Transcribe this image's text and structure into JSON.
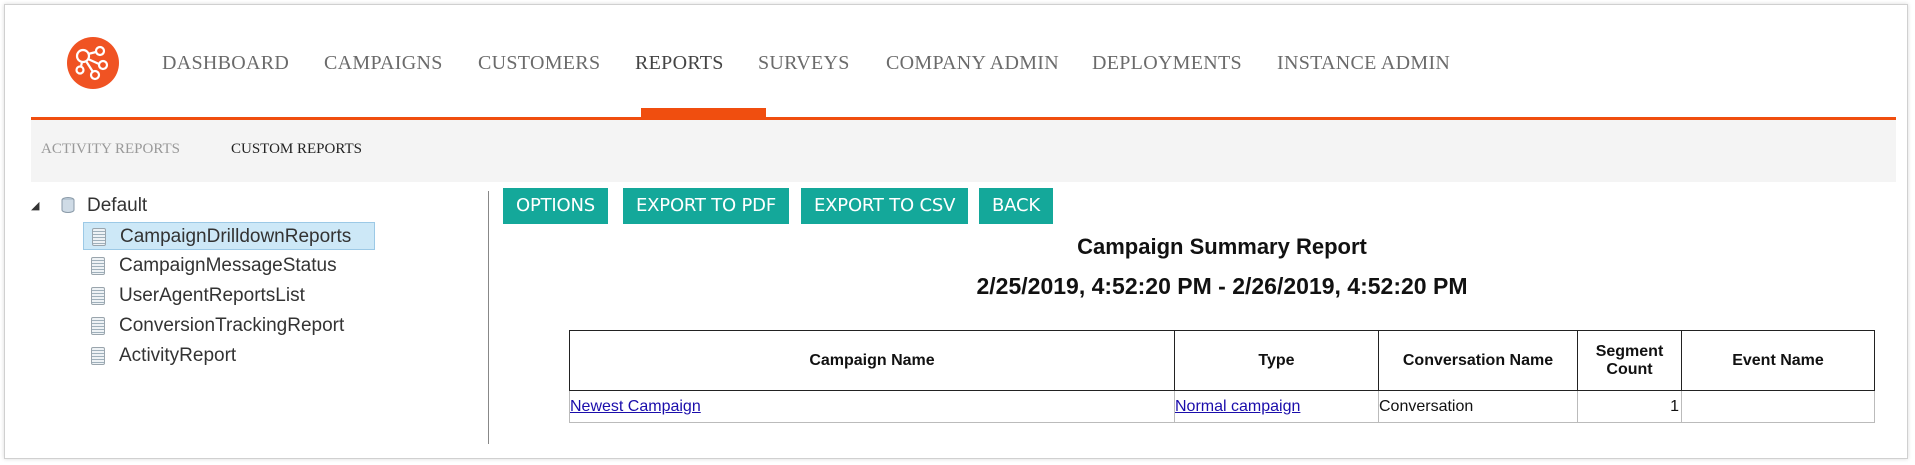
{
  "nav": {
    "items": [
      "DASHBOARD",
      "CAMPAIGNS",
      "CUSTOMERS",
      "REPORTS",
      "SURVEYS",
      "COMPANY ADMIN",
      "DEPLOYMENTS",
      "INSTANCE ADMIN"
    ],
    "active": "REPORTS",
    "accent_color": "#f04e0f"
  },
  "subnav": {
    "items": [
      "ACTIVITY REPORTS",
      "CUSTOM REPORTS"
    ],
    "active": "CUSTOM REPORTS"
  },
  "tree": {
    "root_label": "Default",
    "nodes": [
      "CampaignDrilldownReports",
      "CampaignMessageStatus",
      "UserAgentReportsList",
      "ConversionTrackingReport",
      "ActivityReport"
    ],
    "selected": "CampaignDrilldownReports"
  },
  "toolbar": {
    "options_label": "OPTIONS",
    "export_pdf_label": "EXPORT TO PDF",
    "export_csv_label": "EXPORT TO CSV",
    "back_label": "BACK",
    "button_color": "#14a89a"
  },
  "report": {
    "title": "Campaign Summary Report",
    "date_range": "2/25/2019, 4:52:20 PM  - 2/26/2019, 4:52:20 PM",
    "columns": [
      "Campaign Name",
      "Type",
      "Conversation Name",
      "Segment Count",
      "Event Name"
    ],
    "rows": [
      {
        "campaign_name": "Newest Campaign",
        "type": "Normal campaign",
        "conversation_name": "Conversation",
        "segment_count": "1",
        "event_name": ""
      }
    ]
  }
}
